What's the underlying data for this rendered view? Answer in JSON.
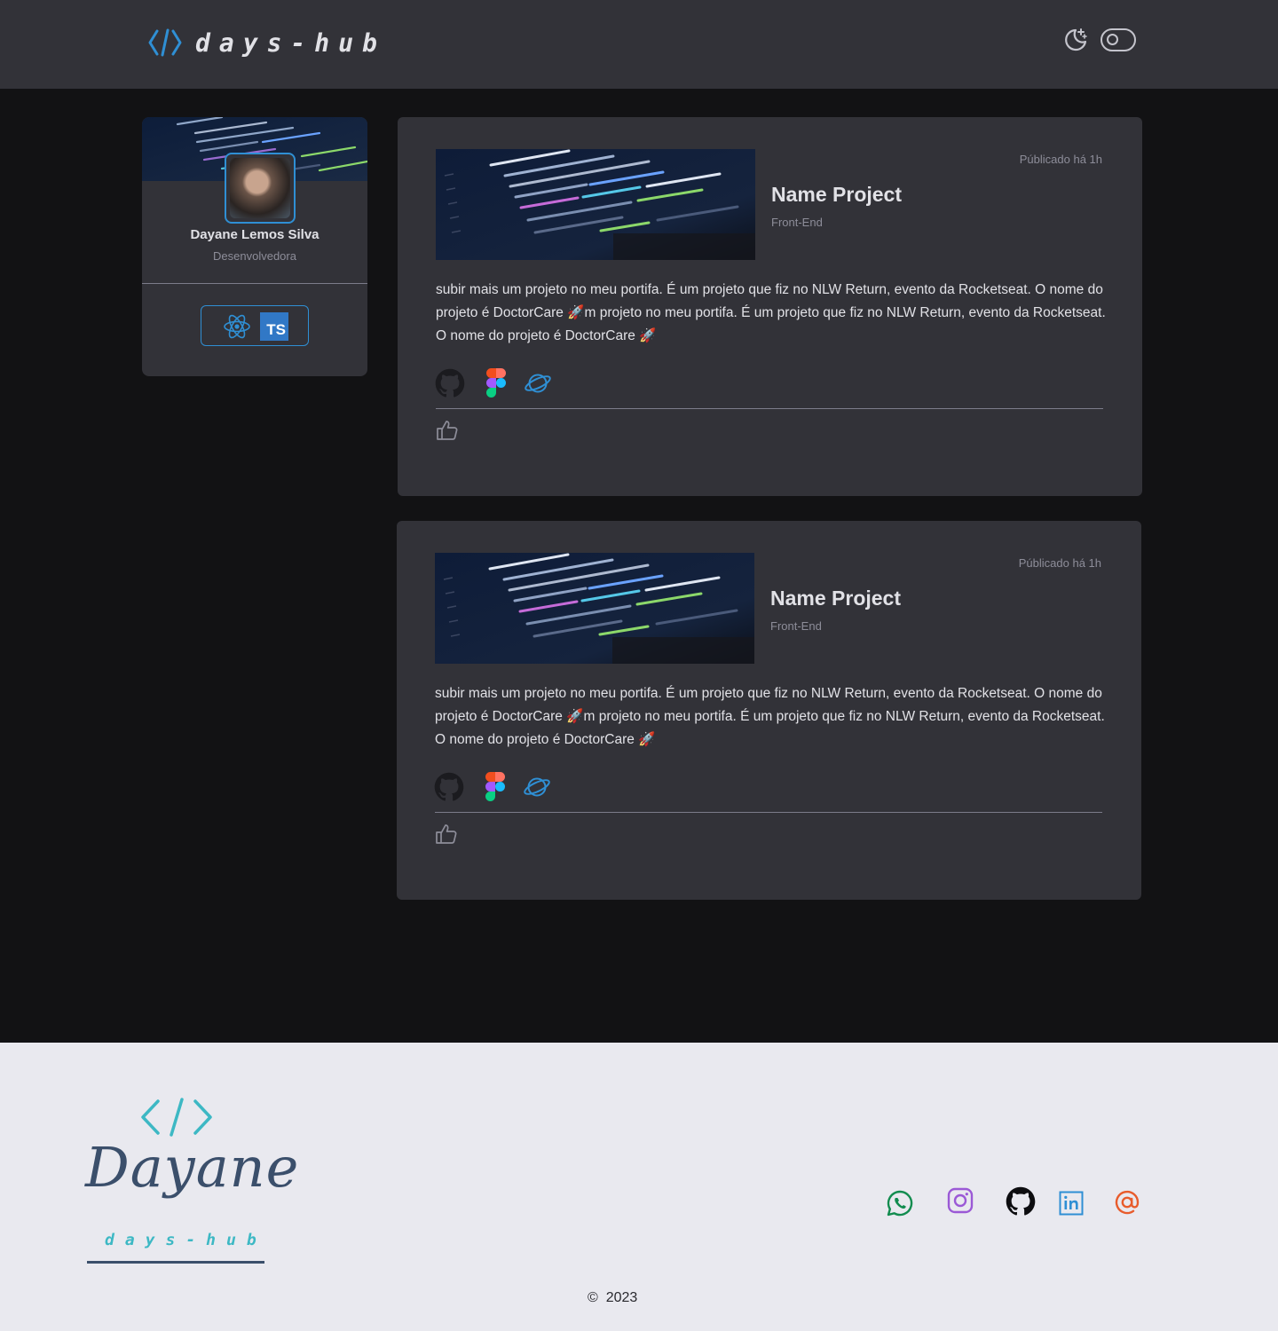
{
  "header": {
    "brand": "days-hub",
    "theme_icon": "moon-stars-icon",
    "toggle_icon": "toggle-switch-icon"
  },
  "profile": {
    "name": "Dayane Lemos Silva",
    "role": "Desenvolvedora",
    "techs": [
      {
        "name": "react-icon"
      },
      {
        "name": "typescript-icon",
        "label": "TS"
      }
    ]
  },
  "posts": [
    {
      "date": "Públicado há 1h",
      "title": "Name Project",
      "category": "Front-End",
      "description": " subir mais um projeto no meu portifa. É um projeto que fiz no NLW Return, evento da Rocketseat. O nome do projeto é DoctorCare 🚀m projeto no meu portifa. É um projeto que fiz no NLW Return, evento da Rocketseat. O nome do projeto é DoctorCare 🚀",
      "links": [
        "github-icon",
        "figma-icon",
        "planet-icon"
      ],
      "action": "like-icon"
    },
    {
      "date": "Públicado há 1h",
      "title": "Name Project",
      "category": "Front-End",
      "description": " subir mais um projeto no meu portifa. É um projeto que fiz no NLW Return, evento da Rocketseat. O nome do projeto é DoctorCare 🚀m projeto no meu portifa. É um projeto que fiz no NLW Return, evento da Rocketseat. O nome do projeto é DoctorCare 🚀",
      "links": [
        "github-icon",
        "figma-icon",
        "planet-icon"
      ],
      "action": "like-icon"
    }
  ],
  "footer": {
    "logo_name": "Dayane",
    "logo_sub": "days-hub",
    "social": [
      "whatsapp-icon",
      "instagram-icon",
      "github-icon",
      "linkedin-icon",
      "email-at-icon"
    ],
    "copyright_symbol": "©",
    "year": "2023"
  },
  "colors": {
    "background": "#121214",
    "surface": "#323238",
    "accent_blue": "#2f8fd4",
    "footer_bg": "#e9e9ef",
    "footer_teal": "#3db8c4",
    "footer_navy": "#3b4f6b"
  }
}
